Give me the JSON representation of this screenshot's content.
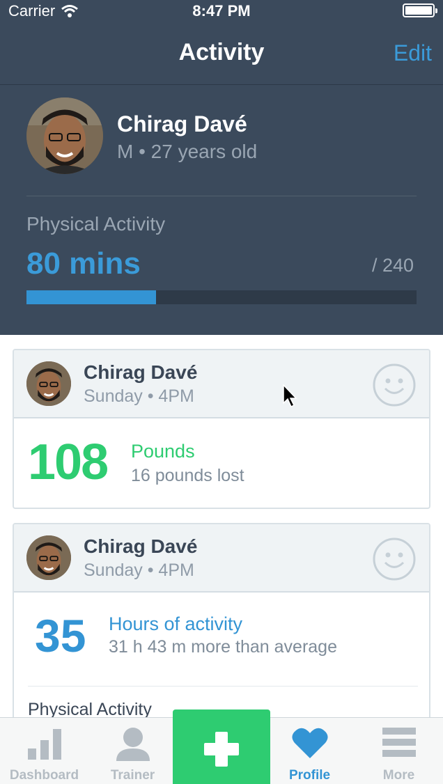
{
  "status_bar": {
    "carrier": "Carrier",
    "time": "8:47 PM"
  },
  "nav": {
    "title": "Activity",
    "edit_label": "Edit"
  },
  "profile": {
    "name": "Chirag Davé",
    "meta": "M • 27 years old"
  },
  "physical_activity": {
    "label": "Physical Activity",
    "value": "80 mins",
    "goal": "/ 240",
    "progress_fraction": 0.333
  },
  "cards": [
    {
      "name": "Chirag Davé",
      "time": "Sunday • 4PM",
      "big_value": "108",
      "label": "Pounds",
      "sub": "16 pounds lost"
    },
    {
      "name": "Chirag Davé",
      "time": "Sunday • 4PM",
      "big_value": "35",
      "label": "Hours of activity",
      "sub": "31 h 43 m more than average",
      "section_label": "Physical Activity"
    }
  ],
  "tabbar": {
    "items": [
      {
        "label": "Dashboard",
        "icon": "bar-chart-icon"
      },
      {
        "label": "Trainer",
        "icon": "user-icon"
      },
      {
        "label": "",
        "icon": "plus-icon"
      },
      {
        "label": "Profile",
        "icon": "heart-icon"
      },
      {
        "label": "More",
        "icon": "menu-icon"
      }
    ],
    "active_index": 3
  },
  "colors": {
    "header_bg": "#3b4a5c",
    "accent_blue": "#3394d4",
    "accent_green": "#2ecc71"
  }
}
